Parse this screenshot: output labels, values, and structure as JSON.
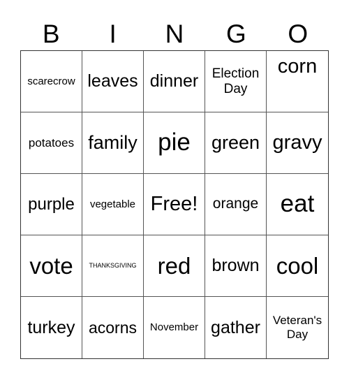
{
  "header": [
    "B",
    "I",
    "N",
    "G",
    "O"
  ],
  "cells": [
    {
      "text": "scarecrow",
      "size": 15
    },
    {
      "text": "leaves",
      "size": 25
    },
    {
      "text": "dinner",
      "size": 25
    },
    {
      "text": "Election Day",
      "size": 19
    },
    {
      "text": "corn",
      "size": 29,
      "top": true
    },
    {
      "text": "potatoes",
      "size": 17
    },
    {
      "text": "family",
      "size": 27
    },
    {
      "text": "pie",
      "size": 35
    },
    {
      "text": "green",
      "size": 27
    },
    {
      "text": "gravy",
      "size": 29
    },
    {
      "text": "purple",
      "size": 24
    },
    {
      "text": "vegetable",
      "size": 15
    },
    {
      "text": "Free!",
      "size": 29
    },
    {
      "text": "orange",
      "size": 21
    },
    {
      "text": "eat",
      "size": 35
    },
    {
      "text": "vote",
      "size": 33
    },
    {
      "text": "THANKSGIVING",
      "size": 9
    },
    {
      "text": "red",
      "size": 33
    },
    {
      "text": "brown",
      "size": 25
    },
    {
      "text": "cool",
      "size": 33
    },
    {
      "text": "turkey",
      "size": 25
    },
    {
      "text": "acorns",
      "size": 23
    },
    {
      "text": "November",
      "size": 15
    },
    {
      "text": "gather",
      "size": 25
    },
    {
      "text": "Veteran's Day",
      "size": 17
    }
  ]
}
